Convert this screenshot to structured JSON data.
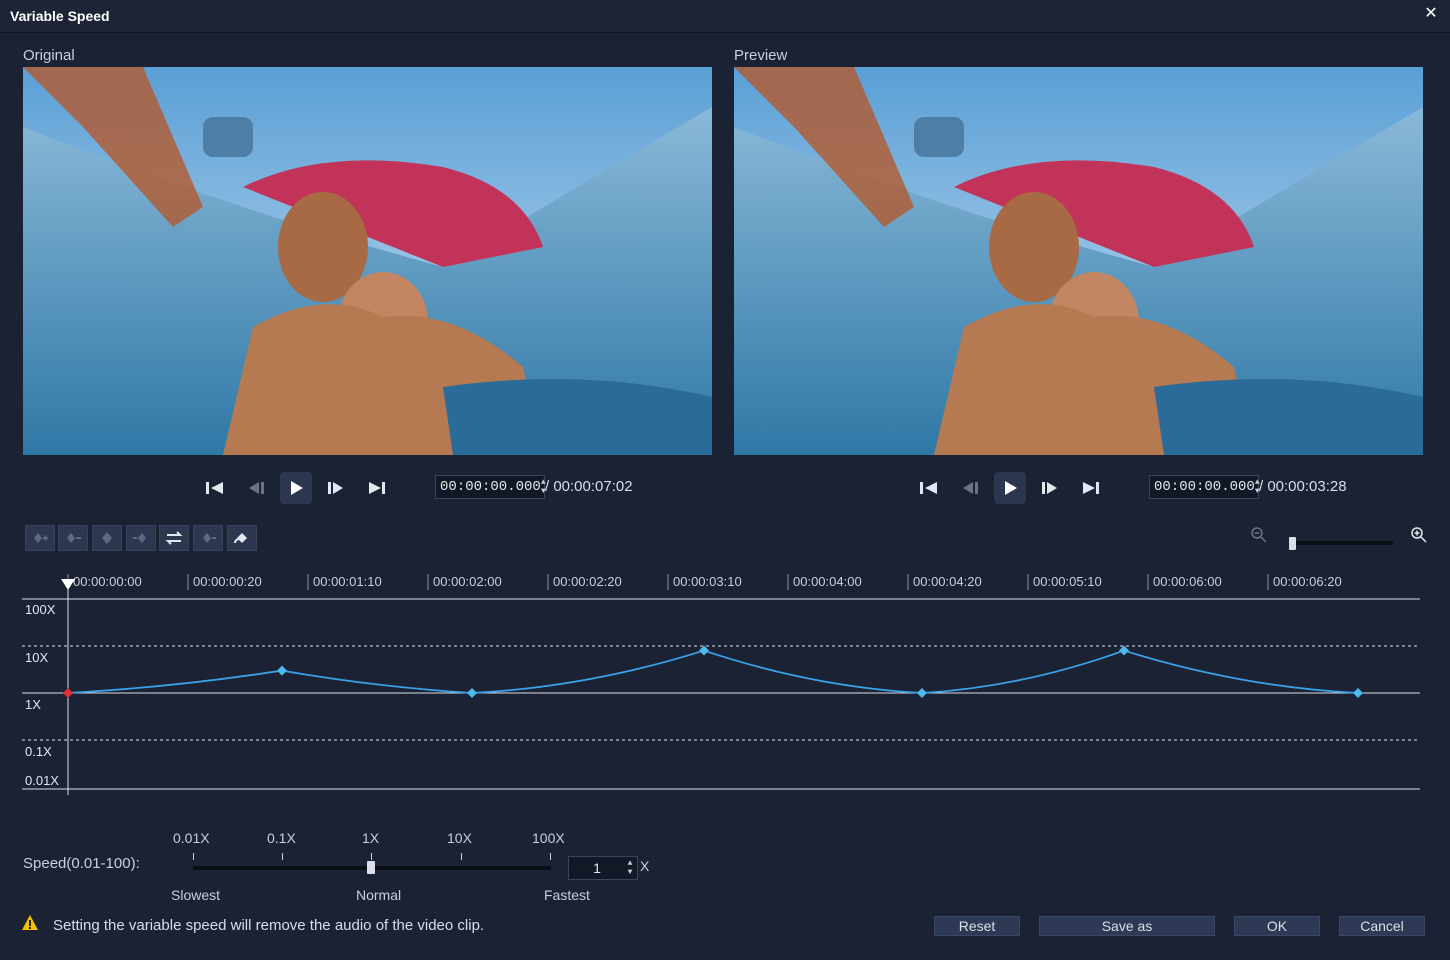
{
  "window": {
    "title": "Variable Speed",
    "close_glyph": "✕"
  },
  "panels": {
    "original": {
      "label": "Original",
      "current_time": "00:00:00.000",
      "duration": "/ 00:00:07:02"
    },
    "preview": {
      "label": "Preview",
      "current_time": "00:00:00.000",
      "duration": "/ 00:00:03:28"
    }
  },
  "ruler": {
    "ticks": [
      "00:00:00:00",
      "00:00:00:20",
      "00:00:01:10",
      "00:00:02:00",
      "00:00:02:20",
      "00:00:03:10",
      "00:00:04:00",
      "00:00:04:20",
      "00:00:05:10",
      "00:00:06:00",
      "00:00:06:20"
    ]
  },
  "graph": {
    "y_labels": [
      "100X",
      "10X",
      "1X",
      "0.1X",
      "0.01X"
    ],
    "keyframes": [
      {
        "time_s": 0.0,
        "speed": 1
      },
      {
        "time_s": 1.07,
        "speed": 3
      },
      {
        "time_s": 2.02,
        "speed": 1
      },
      {
        "time_s": 3.18,
        "speed": 8
      },
      {
        "time_s": 4.27,
        "speed": 1
      },
      {
        "time_s": 5.28,
        "speed": 8
      },
      {
        "time_s": 6.45,
        "speed": 1
      }
    ],
    "colors": {
      "curve": "#3aa0e8",
      "keyframe": "#4fb8ec",
      "start_marker": "#e03030"
    }
  },
  "speed": {
    "label": "Speed(0.01-100):",
    "scale_labels": [
      "0.01X",
      "0.1X",
      "1X",
      "10X",
      "100X"
    ],
    "slowest": "Slowest",
    "normal": "Normal",
    "fastest": "Fastest",
    "value": "1",
    "unit": "X"
  },
  "warning": {
    "text": "Setting the variable speed will remove the audio of the video clip.",
    "icon": "warning-icon"
  },
  "buttons": {
    "reset": "Reset",
    "save_as": "Save as",
    "ok": "OK",
    "cancel": "Cancel"
  }
}
